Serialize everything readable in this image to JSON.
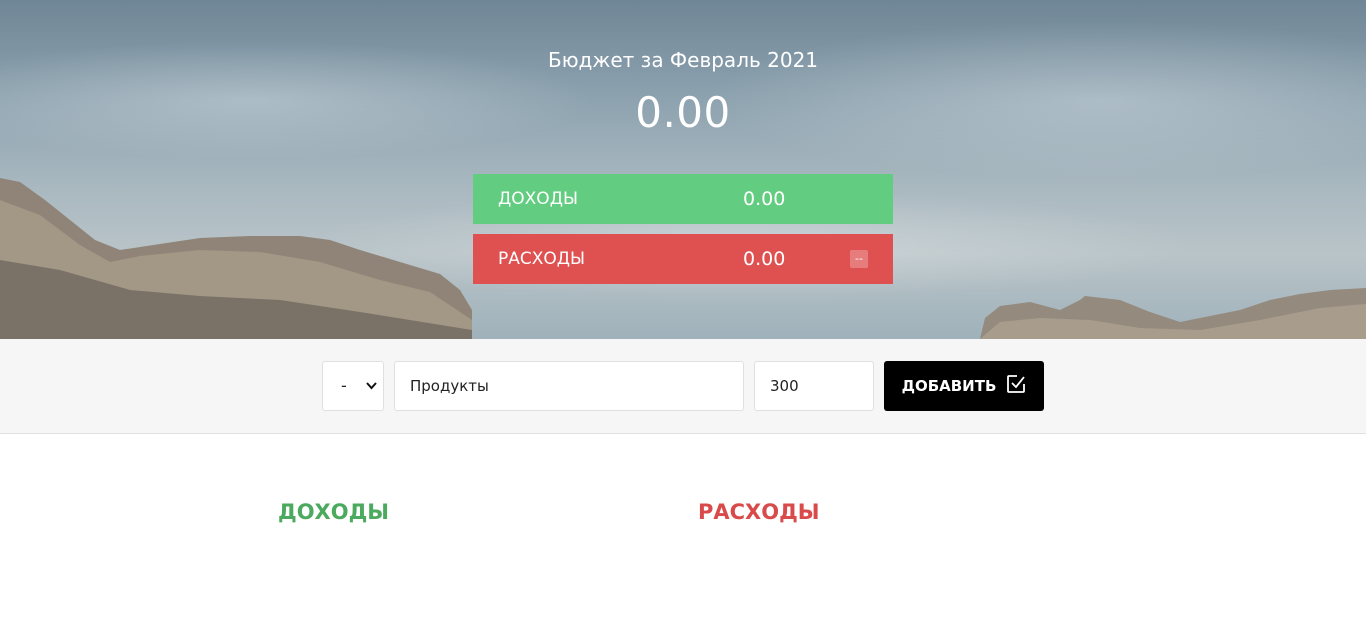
{
  "header": {
    "title": "Бюджет за Февраль 2021",
    "total": "0.00"
  },
  "summary": {
    "income": {
      "label": "Доходы",
      "value": "0.00"
    },
    "expense": {
      "label": "Расходы",
      "value": "0.00",
      "percentage": "--"
    }
  },
  "add_form": {
    "type_value": "-",
    "description_value": "Продукты",
    "amount_value": "300",
    "button_label": "ДОБАВИТЬ",
    "button_icon": "check-square-icon"
  },
  "columns": {
    "income_title": "Доходы",
    "expense_title": "Расходы"
  },
  "colors": {
    "income": "#62cd80",
    "expense": "#df5151",
    "income_text": "#4caa5f",
    "expense_text": "#d94a4a",
    "button": "#000000"
  }
}
